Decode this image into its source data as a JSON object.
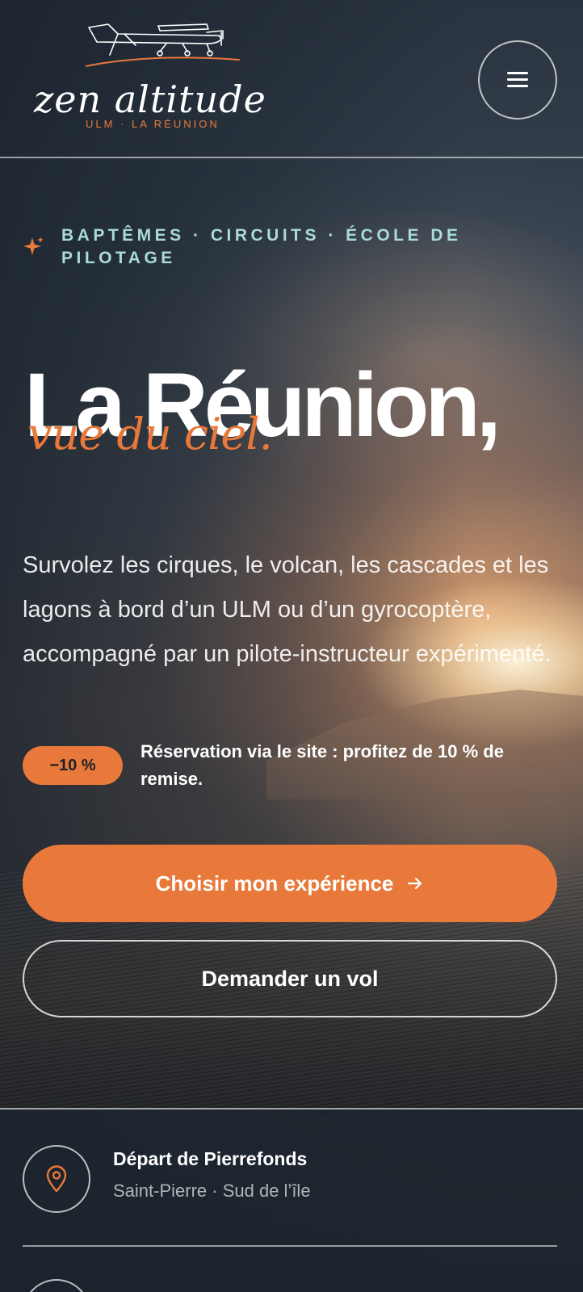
{
  "header": {
    "logo_wordmark": "zen altitude",
    "logo_tagline": "ULM · LA RÉUNION",
    "menu_icon": "hamburger-menu-icon"
  },
  "hero": {
    "eyebrow": "BAPTÊMES · CIRCUITS · ÉCOLE DE PILOTAGE",
    "eyebrow_icon": "sparkle-icon",
    "title": "La Réunion,",
    "subtitle": "vue du ciel.",
    "lead": "Survolez les cirques, le volcan, les cascades et les lagons à bord d’un ULM ou d’un gyrocoptère, accompagné par un pilote-instructeur expérimenté.",
    "promo_badge": "−10 %",
    "promo_text": "Réservation via le site : profitez de 10 % de remise.",
    "cta_primary": "Choisir mon expérience",
    "cta_primary_icon": "arrow-right-icon",
    "cta_secondary": "Demander un vol"
  },
  "info": {
    "items": [
      {
        "icon": "map-pin-icon",
        "title": "Départ de Pierrefonds",
        "subtitle": "Saint-Pierre · Sud de l’île"
      }
    ]
  },
  "colors": {
    "accent": "#e8793a",
    "eyebrow": "#a9dbd8",
    "dark": "#1b2028"
  }
}
